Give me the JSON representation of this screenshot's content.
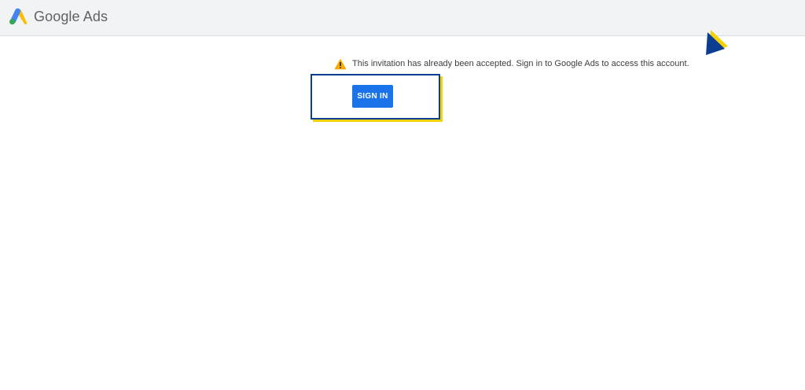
{
  "header": {
    "brand_name": "Google Ads",
    "logo_icon": "google-ads-logo-icon"
  },
  "notice": {
    "icon": "warning-icon",
    "message": "This invitation has already been accepted. Sign in to Google Ads to access this account."
  },
  "actions": {
    "sign_in_label": "SIGN IN"
  },
  "colors": {
    "header_bg": "#f1f3f4",
    "button_bg": "#1a73e8",
    "warning": "#f9ab00",
    "highlight_border": "#0b3d91",
    "highlight_shadow": "#f2d200"
  }
}
